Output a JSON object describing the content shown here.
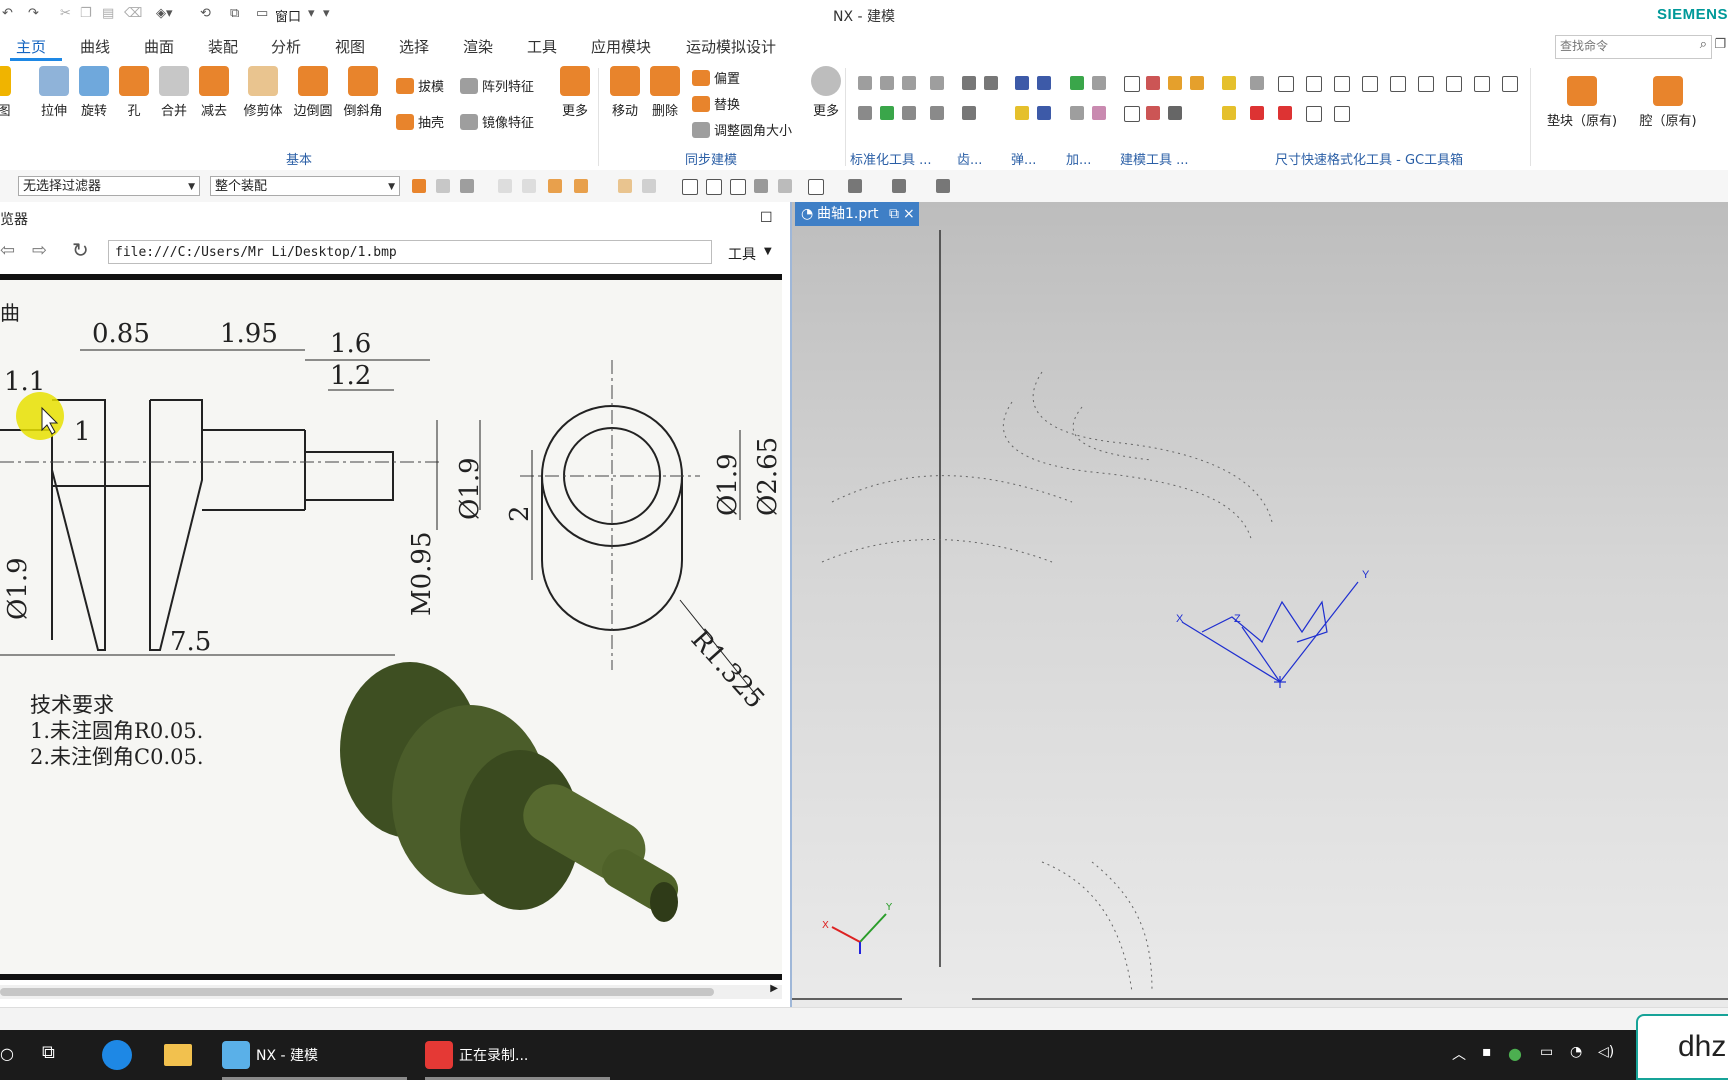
{
  "titlebar": {
    "title": "NX - 建模",
    "brand": "SIEMENS",
    "window_menu": "窗口"
  },
  "menu": {
    "tabs": [
      "主页",
      "曲线",
      "曲面",
      "装配",
      "分析",
      "视图",
      "选择",
      "渲染",
      "工具",
      "应用模块",
      "运动模拟设计"
    ],
    "search_placeholder": "查找命令"
  },
  "ribbon": {
    "big_buttons": [
      "拉伸",
      "旋转",
      "孔",
      "合并",
      "减去",
      "修剪体",
      "边倒圆",
      "倒斜角",
      "更多",
      "移动",
      "删除",
      "更多",
      "垫块（原有)",
      "腔（原有)"
    ],
    "small_buttons": [
      "拔模",
      "阵列特征",
      "抽壳",
      "镜像特征",
      "偏置",
      "替换",
      "调整圆角大小"
    ],
    "groups": [
      "基本",
      "同步建模",
      "标准化工具 ...",
      "齿...",
      "弹...",
      "加...",
      "建模工具 ...",
      "尺寸快速格式化工具 - GC工具箱"
    ],
    "left_partial": "图"
  },
  "filterbar": {
    "filter_value": "无选择过滤器",
    "scope_value": "整个装配"
  },
  "browser": {
    "title": "览器",
    "url": "file:///C:/Users/Mr Li/Desktop/1.bmp",
    "tools_label": "工具"
  },
  "drawing": {
    "dimensions": [
      "0.85",
      "1.95",
      "1.6",
      "1.2",
      "1.1",
      "1",
      "Ø1.9",
      "M0.95",
      "2",
      "Ø1.9",
      "Ø2.65",
      "R1.325",
      "7.5",
      "Ø1.9"
    ],
    "notes_title": "技术要求",
    "notes": [
      "1.未注圆角R0.05.",
      "2.未注倒角C0.05."
    ],
    "left_partial": "曲"
  },
  "graphics": {
    "tab_label": "曲轴1.prt",
    "axis_labels": [
      "X",
      "Y",
      "Z"
    ]
  },
  "taskbar": {
    "apps": [
      "NX - 建模",
      "正在录制..."
    ],
    "overlay_text": "dhz"
  },
  "colors": {
    "accent": "#1e88e5",
    "brand": "#009999",
    "tab_blue": "#3f7fc6",
    "icon_orange": "#e8842c",
    "part_green": "#4b5d2a"
  }
}
